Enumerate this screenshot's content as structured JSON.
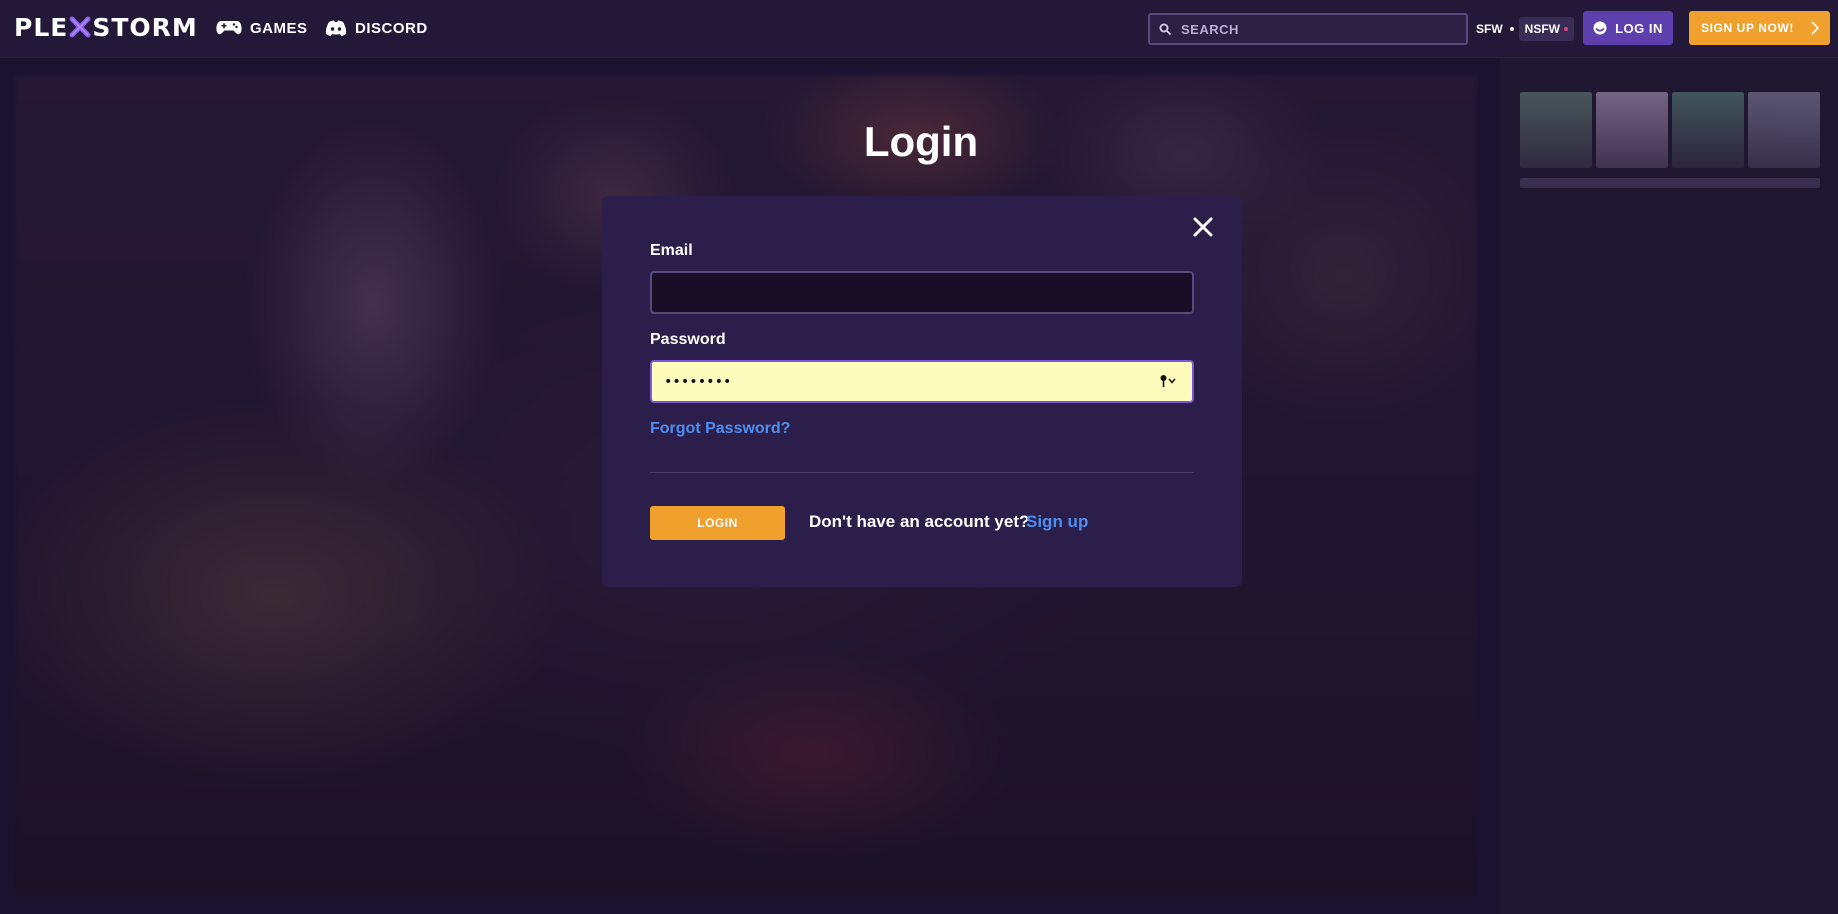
{
  "brand": {
    "logo_left": "PLE",
    "logo_right": "STORM"
  },
  "nav": {
    "games_label": "GAMES",
    "discord_label": "DISCORD"
  },
  "search": {
    "placeholder": "SEARCH"
  },
  "mode": {
    "sfw_label": "SFW",
    "nsfw_label": "NSFW",
    "selected": "NSFW"
  },
  "header": {
    "login_label": "LOG IN",
    "signup_label": "SIGN UP NOW!"
  },
  "login_form": {
    "title": "Login",
    "email_label": "Email",
    "email_value": "",
    "password_label": "Password",
    "password_value": "••••••••",
    "forgot_label": "Forgot Password?",
    "submit_label": "LOGIN",
    "no_account_text": "Don't have an account yet?",
    "signup_link_label": "Sign up"
  },
  "colors": {
    "accent_purple": "#5e3fae",
    "accent_orange": "#f0a02c",
    "link_blue": "#4d8ef0",
    "modal_bg": "#2c1e4a",
    "autofill_yellow": "#fdfcbc"
  },
  "icons": [
    "gamepad-icon",
    "discord-icon",
    "search-icon",
    "user-icon",
    "chevron-right-icon",
    "close-icon",
    "key-icon"
  ]
}
